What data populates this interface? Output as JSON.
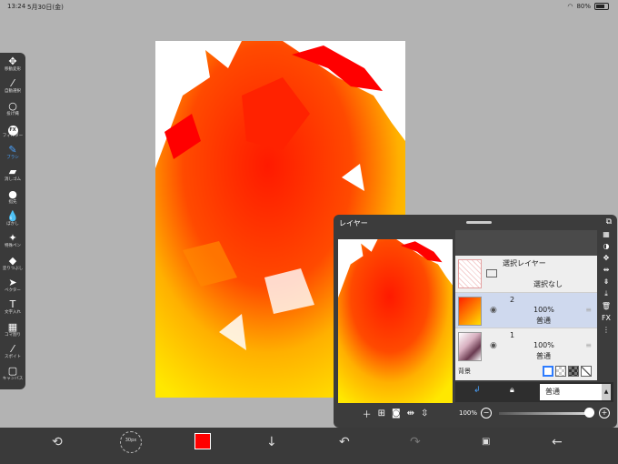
{
  "status": {
    "time": "13:24",
    "date": "5月30日(金)",
    "battery": "80%"
  },
  "tools": [
    {
      "label": "移動変形",
      "icon": "move-icon",
      "glyph": "✥"
    },
    {
      "label": "自動選択",
      "icon": "magic-wand-icon",
      "glyph": "⁄"
    },
    {
      "label": "投げ縄",
      "icon": "lasso-icon",
      "glyph": "○"
    },
    {
      "label": "フィルター",
      "icon": "fx-filter-icon",
      "glyph": "FX"
    },
    {
      "label": "ブラシ",
      "icon": "brush-icon",
      "glyph": "✎"
    },
    {
      "label": "消しゴム",
      "icon": "eraser-icon",
      "glyph": "▰"
    },
    {
      "label": "指先",
      "icon": "smudge-icon",
      "glyph": "●"
    },
    {
      "label": "ぼかし",
      "icon": "blur-drop-icon",
      "glyph": "💧"
    },
    {
      "label": "特殊ペン",
      "icon": "special-pen-icon",
      "glyph": "✦"
    },
    {
      "label": "塗りつぶし",
      "icon": "bucket-fill-icon",
      "glyph": "◆"
    },
    {
      "label": "ベクター",
      "icon": "vector-icon",
      "glyph": "➤"
    },
    {
      "label": "文字入れ",
      "icon": "text-icon",
      "glyph": "T"
    },
    {
      "label": "コマ割り",
      "icon": "frame-divider-icon",
      "glyph": "▦"
    },
    {
      "label": "スポイト",
      "icon": "eyedropper-icon",
      "glyph": "⁄"
    },
    {
      "label": "キャンバス",
      "icon": "canvas-icon",
      "glyph": "▢"
    }
  ],
  "layer_panel": {
    "title": "レイヤー",
    "selection_layer": {
      "title": "選択レイヤー",
      "status": "選択なし"
    },
    "layers": [
      {
        "number": "2",
        "opacity": "100%",
        "mode": "普通"
      },
      {
        "number": "1",
        "opacity": "100%",
        "mode": "普通"
      }
    ],
    "background_label": "背景",
    "blend_mode": "普通",
    "opacity_label": "100%"
  },
  "brush_size": "30px",
  "colors": {
    "primary": "#ff0000"
  }
}
